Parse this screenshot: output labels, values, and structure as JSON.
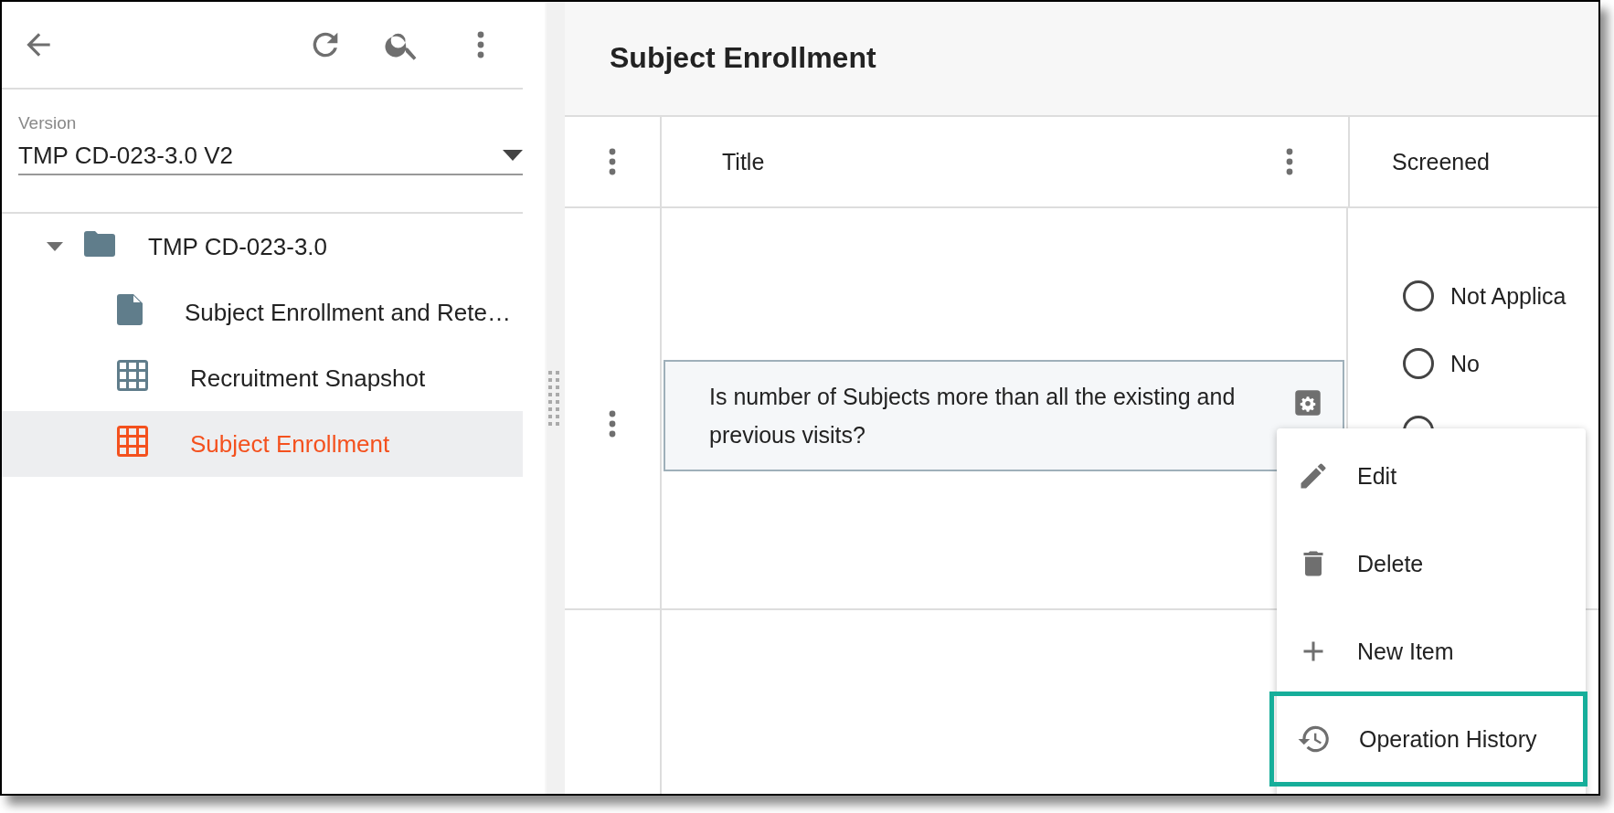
{
  "version": {
    "label": "Version",
    "value": "TMP CD-023-3.0 V2"
  },
  "tree": [
    {
      "label": "TMP CD-023-3.0",
      "kind": "folder",
      "expanded": true,
      "selected": false,
      "children": [
        {
          "label": "Subject Enrollment and Rete…",
          "kind": "document",
          "selected": false
        },
        {
          "label": "Recruitment Snapshot",
          "kind": "table",
          "selected": false
        },
        {
          "label": "Subject Enrollment",
          "kind": "table",
          "selected": true
        }
      ]
    }
  ],
  "page": {
    "title": "Subject Enrollment"
  },
  "table": {
    "columns": [
      "Title",
      "Screened"
    ],
    "rows": [
      {
        "title": "Is number of Subjects more than all the existing and previous visits?",
        "selected": true,
        "screened": [
          {
            "label": "Not Applica",
            "selected": false
          },
          {
            "label": "No",
            "selected": false
          },
          {
            "selected": false
          }
        ]
      }
    ]
  },
  "context_menu": {
    "items": [
      {
        "label": "Edit",
        "kind": "edit",
        "highlighted": false
      },
      {
        "label": "Delete",
        "kind": "delete",
        "highlighted": false
      },
      {
        "label": "New Item",
        "kind": "add",
        "highlighted": false
      },
      {
        "label": "Operation History",
        "kind": "history",
        "highlighted": true
      }
    ]
  }
}
